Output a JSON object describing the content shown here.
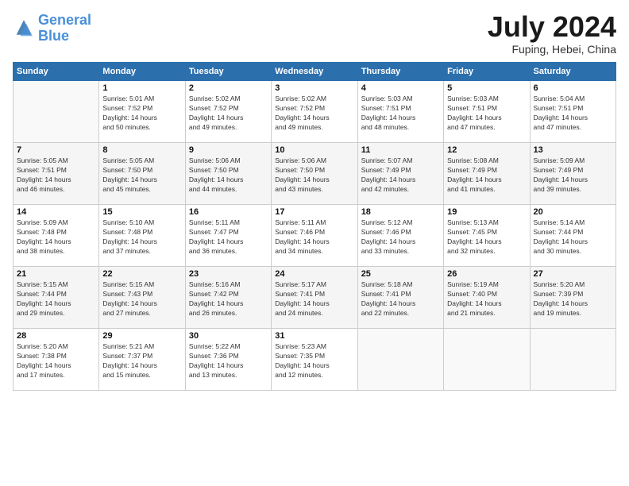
{
  "logo": {
    "text_general": "General",
    "text_blue": "Blue"
  },
  "title": "July 2024",
  "subtitle": "Fuping, Hebei, China",
  "headers": [
    "Sunday",
    "Monday",
    "Tuesday",
    "Wednesday",
    "Thursday",
    "Friday",
    "Saturday"
  ],
  "weeks": [
    [
      {
        "day": "",
        "info": "",
        "empty": true
      },
      {
        "day": "1",
        "info": "Sunrise: 5:01 AM\nSunset: 7:52 PM\nDaylight: 14 hours\nand 50 minutes."
      },
      {
        "day": "2",
        "info": "Sunrise: 5:02 AM\nSunset: 7:52 PM\nDaylight: 14 hours\nand 49 minutes."
      },
      {
        "day": "3",
        "info": "Sunrise: 5:02 AM\nSunset: 7:52 PM\nDaylight: 14 hours\nand 49 minutes."
      },
      {
        "day": "4",
        "info": "Sunrise: 5:03 AM\nSunset: 7:51 PM\nDaylight: 14 hours\nand 48 minutes."
      },
      {
        "day": "5",
        "info": "Sunrise: 5:03 AM\nSunset: 7:51 PM\nDaylight: 14 hours\nand 47 minutes."
      },
      {
        "day": "6",
        "info": "Sunrise: 5:04 AM\nSunset: 7:51 PM\nDaylight: 14 hours\nand 47 minutes."
      }
    ],
    [
      {
        "day": "7",
        "info": "Sunrise: 5:05 AM\nSunset: 7:51 PM\nDaylight: 14 hours\nand 46 minutes."
      },
      {
        "day": "8",
        "info": "Sunrise: 5:05 AM\nSunset: 7:50 PM\nDaylight: 14 hours\nand 45 minutes."
      },
      {
        "day": "9",
        "info": "Sunrise: 5:06 AM\nSunset: 7:50 PM\nDaylight: 14 hours\nand 44 minutes."
      },
      {
        "day": "10",
        "info": "Sunrise: 5:06 AM\nSunset: 7:50 PM\nDaylight: 14 hours\nand 43 minutes."
      },
      {
        "day": "11",
        "info": "Sunrise: 5:07 AM\nSunset: 7:49 PM\nDaylight: 14 hours\nand 42 minutes."
      },
      {
        "day": "12",
        "info": "Sunrise: 5:08 AM\nSunset: 7:49 PM\nDaylight: 14 hours\nand 41 minutes."
      },
      {
        "day": "13",
        "info": "Sunrise: 5:09 AM\nSunset: 7:49 PM\nDaylight: 14 hours\nand 39 minutes."
      }
    ],
    [
      {
        "day": "14",
        "info": "Sunrise: 5:09 AM\nSunset: 7:48 PM\nDaylight: 14 hours\nand 38 minutes."
      },
      {
        "day": "15",
        "info": "Sunrise: 5:10 AM\nSunset: 7:48 PM\nDaylight: 14 hours\nand 37 minutes."
      },
      {
        "day": "16",
        "info": "Sunrise: 5:11 AM\nSunset: 7:47 PM\nDaylight: 14 hours\nand 36 minutes."
      },
      {
        "day": "17",
        "info": "Sunrise: 5:11 AM\nSunset: 7:46 PM\nDaylight: 14 hours\nand 34 minutes."
      },
      {
        "day": "18",
        "info": "Sunrise: 5:12 AM\nSunset: 7:46 PM\nDaylight: 14 hours\nand 33 minutes."
      },
      {
        "day": "19",
        "info": "Sunrise: 5:13 AM\nSunset: 7:45 PM\nDaylight: 14 hours\nand 32 minutes."
      },
      {
        "day": "20",
        "info": "Sunrise: 5:14 AM\nSunset: 7:44 PM\nDaylight: 14 hours\nand 30 minutes."
      }
    ],
    [
      {
        "day": "21",
        "info": "Sunrise: 5:15 AM\nSunset: 7:44 PM\nDaylight: 14 hours\nand 29 minutes."
      },
      {
        "day": "22",
        "info": "Sunrise: 5:15 AM\nSunset: 7:43 PM\nDaylight: 14 hours\nand 27 minutes."
      },
      {
        "day": "23",
        "info": "Sunrise: 5:16 AM\nSunset: 7:42 PM\nDaylight: 14 hours\nand 26 minutes."
      },
      {
        "day": "24",
        "info": "Sunrise: 5:17 AM\nSunset: 7:41 PM\nDaylight: 14 hours\nand 24 minutes."
      },
      {
        "day": "25",
        "info": "Sunrise: 5:18 AM\nSunset: 7:41 PM\nDaylight: 14 hours\nand 22 minutes."
      },
      {
        "day": "26",
        "info": "Sunrise: 5:19 AM\nSunset: 7:40 PM\nDaylight: 14 hours\nand 21 minutes."
      },
      {
        "day": "27",
        "info": "Sunrise: 5:20 AM\nSunset: 7:39 PM\nDaylight: 14 hours\nand 19 minutes."
      }
    ],
    [
      {
        "day": "28",
        "info": "Sunrise: 5:20 AM\nSunset: 7:38 PM\nDaylight: 14 hours\nand 17 minutes."
      },
      {
        "day": "29",
        "info": "Sunrise: 5:21 AM\nSunset: 7:37 PM\nDaylight: 14 hours\nand 15 minutes."
      },
      {
        "day": "30",
        "info": "Sunrise: 5:22 AM\nSunset: 7:36 PM\nDaylight: 14 hours\nand 13 minutes."
      },
      {
        "day": "31",
        "info": "Sunrise: 5:23 AM\nSunset: 7:35 PM\nDaylight: 14 hours\nand 12 minutes."
      },
      {
        "day": "",
        "info": "",
        "empty": true
      },
      {
        "day": "",
        "info": "",
        "empty": true
      },
      {
        "day": "",
        "info": "",
        "empty": true
      }
    ]
  ]
}
